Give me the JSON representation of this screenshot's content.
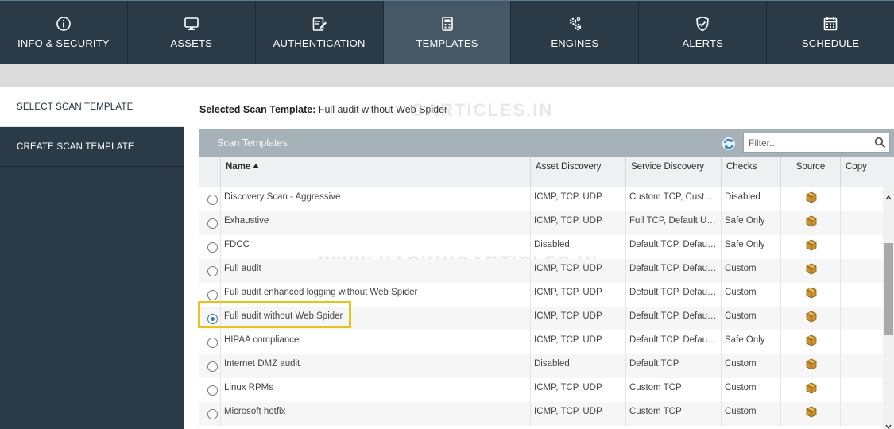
{
  "nav": {
    "tabs": [
      {
        "label": "INFO & SECURITY",
        "icon": "info-icon"
      },
      {
        "label": "ASSETS",
        "icon": "monitor-icon"
      },
      {
        "label": "AUTHENTICATION",
        "icon": "edit-icon"
      },
      {
        "label": "TEMPLATES",
        "icon": "calculator-icon",
        "active": true
      },
      {
        "label": "ENGINES",
        "icon": "gears-icon"
      },
      {
        "label": "ALERTS",
        "icon": "shield-check-icon"
      },
      {
        "label": "SCHEDULE",
        "icon": "calendar-icon"
      }
    ]
  },
  "sidebar": {
    "items": [
      {
        "label": "SELECT SCAN TEMPLATE",
        "active": true
      },
      {
        "label": "CREATE SCAN TEMPLATE",
        "active": false
      }
    ]
  },
  "main": {
    "selected_label": "Selected Scan Template:",
    "selected_value": "Full audit without Web Spider"
  },
  "panel": {
    "title": "Scan Templates",
    "filter_placeholder": "Filter..."
  },
  "table": {
    "headers": {
      "name": "Name",
      "asset_discovery": "Asset Discovery",
      "service_discovery": "Service Discovery",
      "checks": "Checks",
      "source": "Source",
      "copy": "Copy"
    },
    "rows": [
      {
        "name": "Discovery Scan - Aggressive",
        "asset": "ICMP, TCP, UDP",
        "service": "Custom TCP, Custom UDP",
        "checks": "Disabled",
        "selected": false
      },
      {
        "name": "Exhaustive",
        "asset": "ICMP, TCP, UDP",
        "service": "Full TCP, Default UDP",
        "checks": "Safe Only",
        "selected": false
      },
      {
        "name": "FDCC",
        "asset": "Disabled",
        "service": "Default TCP, Default UDP",
        "checks": "Safe Only",
        "selected": false
      },
      {
        "name": "Full audit",
        "asset": "ICMP, TCP, UDP",
        "service": "Default TCP, Default UDP",
        "checks": "Custom",
        "selected": false
      },
      {
        "name": "Full audit enhanced logging without Web Spider",
        "asset": "ICMP, TCP, UDP",
        "service": "Default TCP, Default UDP",
        "checks": "Custom",
        "selected": false
      },
      {
        "name": "Full audit without Web Spider",
        "asset": "ICMP, TCP, UDP",
        "service": "Default TCP, Default UDP",
        "checks": "Custom",
        "selected": true
      },
      {
        "name": "HIPAA compliance",
        "asset": "ICMP, TCP, UDP",
        "service": "Default TCP, Default UDP",
        "checks": "Safe Only",
        "selected": false
      },
      {
        "name": "Internet DMZ audit",
        "asset": "Disabled",
        "service": "Default TCP",
        "checks": "Custom",
        "selected": false
      },
      {
        "name": "Linux RPMs",
        "asset": "ICMP, TCP, UDP",
        "service": "Custom TCP",
        "checks": "Custom",
        "selected": false
      },
      {
        "name": "Microsoft hotfix",
        "asset": "ICMP, TCP, UDP",
        "service": "Custom TCP",
        "checks": "Custom",
        "selected": false
      }
    ]
  },
  "watermark": {
    "top": "GARTICLES.IN",
    "middle": "WWW.HACKINGARTICLES.IN"
  },
  "colors": {
    "nav_bg": "#2b3a47",
    "nav_active": "#465866",
    "panel_header": "#a7b1b8",
    "highlight": "#e9c21b",
    "radio_checked": "#3d78a8"
  }
}
